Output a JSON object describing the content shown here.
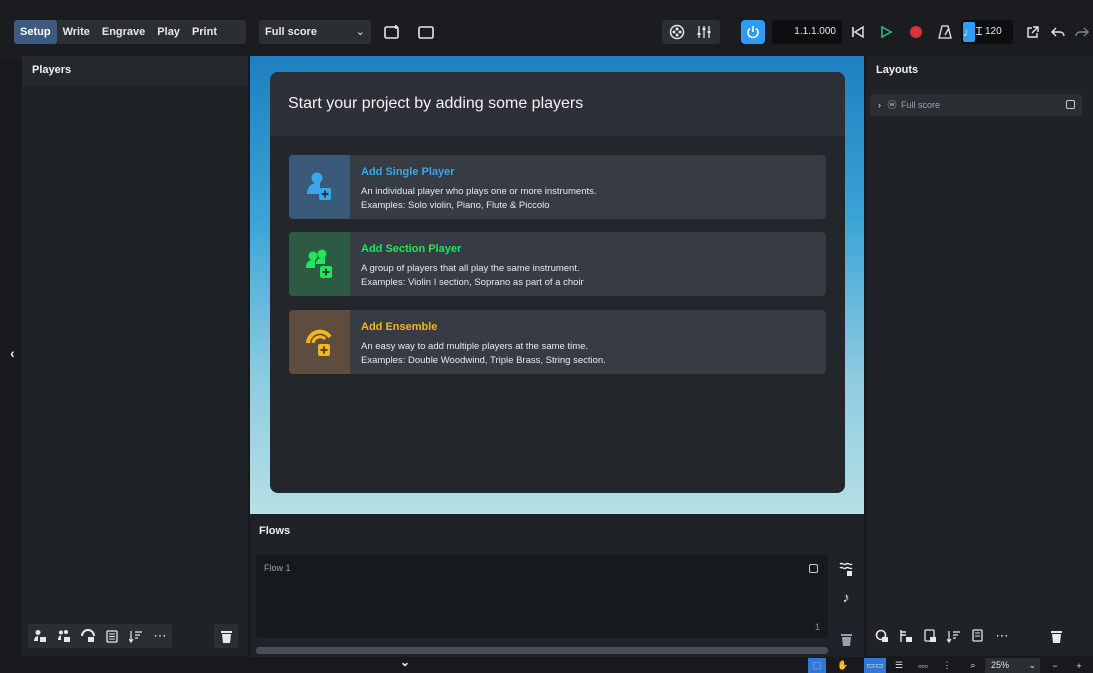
{
  "toolbar": {
    "modes": [
      "Setup",
      "Write",
      "Engrave",
      "Play",
      "Print"
    ],
    "active_mode": "Setup",
    "layout_select": "Full score",
    "timecode": "1.1.1.000",
    "tempo": "120",
    "colors": {
      "accent": "#2f9bf3",
      "record": "#d9343b",
      "play": "#2ec27e"
    }
  },
  "players_panel": {
    "title": "Players",
    "bottom_icons": [
      "add-single-player-icon",
      "add-section-player-icon",
      "add-ensemble-icon",
      "notes-icon",
      "sort-icon",
      "more-icon",
      "delete-icon"
    ]
  },
  "start_card": {
    "heading": "Start your project by adding some players",
    "options": [
      {
        "title": "Add Single Player",
        "line1": "An individual player who plays one or more instruments.",
        "line2": "Examples: Solo violin, Piano, Flute & Piccolo",
        "color": "#39a7ea",
        "bg": "#3a5877",
        "icon": "single-player-icon"
      },
      {
        "title": "Add Section Player",
        "line1": "A group of players that all play the same instrument.",
        "line2": "Examples: Violin I section, Soprano as part of a choir",
        "color": "#1fe65a",
        "bg": "#2c5a43",
        "icon": "section-player-icon"
      },
      {
        "title": "Add Ensemble",
        "line1": "An easy way to add multiple players at the same time.",
        "line2": "Examples: Double Woodwind, Triple Brass, String section.",
        "color": "#f4b51d",
        "bg": "#5e4c3e",
        "icon": "ensemble-icon"
      }
    ]
  },
  "flows": {
    "title": "Flows",
    "flow_name": "Flow 1",
    "flow_number": "1"
  },
  "layouts_panel": {
    "title": "Layouts",
    "row_label": "Full score"
  },
  "statusbar": {
    "zoom": "25%"
  }
}
